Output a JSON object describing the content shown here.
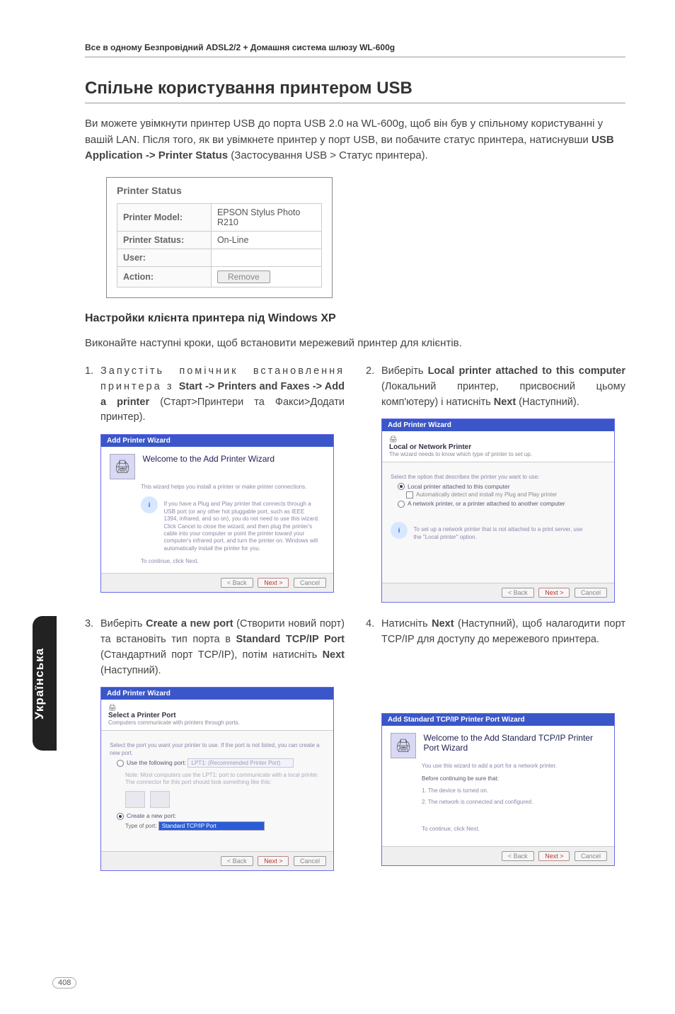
{
  "header": "Все в одному Безпровідний ADSL2/2 + Домашня система шлюзу WL-600g",
  "section_title": "Спільне користування принтером USB",
  "intro_p1": "Ви можете увімкнути принтер USB до порта USB 2.0 на WL-600g, щоб він був у спільному користуванні у вашій LAN. Після того, як ви увімкнете принтер у порт USB, ви побачите статус принтера, натиснувши ",
  "intro_bold": "USB Application -> Printer Status",
  "intro_p2": " (Застосування USB > Статус принтера).",
  "printer_status": {
    "box_title": "Printer Status",
    "labels": {
      "model": "Printer Model:",
      "status": "Printer Status:",
      "user": "User:",
      "action": "Action:"
    },
    "values": {
      "model": "EPSON Stylus Photo R210",
      "status": "On-Line",
      "user": "",
      "remove": "Remove"
    }
  },
  "sub_heading": "Настройки клієнта принтера під Windows XP",
  "sub_intro": "Виконайте наступні кроки, щоб встановити мережевий принтер для клієнтів.",
  "steps": {
    "s1_a": "Запустіть помічник встановлення принтера з ",
    "s1_b": "Start -> Printers and Faxes -> Add a printer",
    "s1_c": " (Старт>Принтери та Факси>Додати принтер).",
    "s2_a": "Виберіть ",
    "s2_b": "Local printer attached to this computer",
    "s2_c": " (Локальний принтер, присвоєний цьому комп'ютеру) і натисніть ",
    "s2_d": "Next",
    "s2_e": " (Наступний).",
    "s3_a": "Виберіть ",
    "s3_b": "Create a new port",
    "s3_c": " (Створити новий порт) та встановіть тип порта в ",
    "s3_d": "Standard TCP/IP Port",
    "s3_e": " (Стандартний порт TCP/IP), потім натисніть ",
    "s3_f": "Next",
    "s3_g": " (Наступний).",
    "s4_a": "Натисніть ",
    "s4_b": "Next",
    "s4_c": " (Наступний), щоб налагодити порт TCP/IP для доступу до мережевого принтера."
  },
  "wizards": {
    "w1": {
      "titlebar": "Add Printer Wizard",
      "heading": "Welcome to the Add Printer Wizard",
      "line1": "This wizard helps you install a printer or make printer connections.",
      "body": "If you have a Plug and Play printer that connects through a USB port (or any other hot pluggable port, such as IEEE 1394, infrared, and so on), you do not need to use this wizard. Click Cancel to close the wizard, and then plug the printer's cable into your computer or point the printer toward your computer's infrared port, and turn the printer on. Windows will automatically install the printer for you.",
      "continue": "To continue, click Next."
    },
    "w2": {
      "titlebar": "Add Printer Wizard",
      "band_title": "Local or Network Printer",
      "band_sub": "The wizard needs to know which type of printer to set up.",
      "prompt": "Select the option that describes the printer you want to use:",
      "opt1": "Local printer attached to this computer",
      "opt1_chk": "Automatically detect and install my Plug and Play printer",
      "opt2": "A network printer, or a printer attached to another computer",
      "tip": "To set up a network printer that is not attached to a print server, use the \"Local printer\" option."
    },
    "w3": {
      "titlebar": "Add Printer Wizard",
      "band_title": "Select a Printer Port",
      "band_sub": "Computers communicate with printers through ports.",
      "prompt": "Select the port you want your printer to use. If the port is not listed, you can create a new port.",
      "opt1": "Use the following port:",
      "opt1_val": "LPT1: (Recommended Printer Port)",
      "note": "Note: Most computers use the LPT1: port to communicate with a local printer. The connector for this port should look something like this:",
      "opt2": "Create a new port:",
      "opt2_label": "Type of port:",
      "opt2_val": "Standard TCP/IP Port"
    },
    "w4": {
      "titlebar": "Add Standard TCP/IP Printer Port Wizard",
      "heading": "Welcome to the Add Standard TCP/IP Printer Port Wizard",
      "line1": "You use this wizard to add a port for a network printer.",
      "before": "Before continuing be sure that:",
      "b1": "1. The device is turned on.",
      "b2": "2. The network is connected and configured.",
      "continue": "To continue, click Next."
    },
    "buttons": {
      "back": "< Back",
      "next": "Next >",
      "cancel": "Cancel"
    }
  },
  "side_tab": "Українська",
  "page_number": "408"
}
